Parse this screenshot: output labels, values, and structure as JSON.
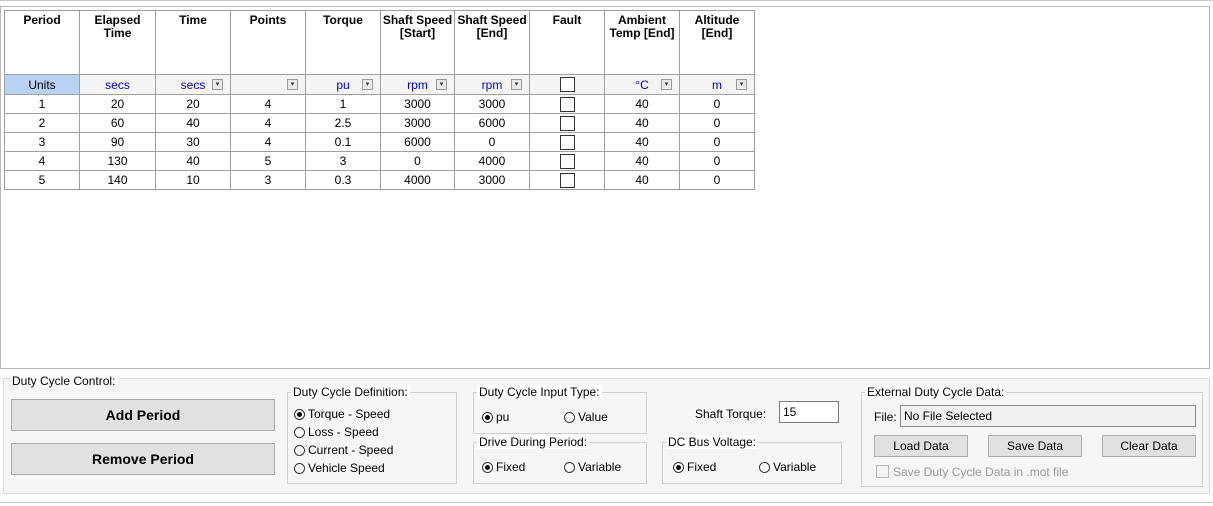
{
  "grid": {
    "columns": [
      {
        "key": "period",
        "header": "Period",
        "unit": "Units",
        "has_dropdown": false
      },
      {
        "key": "elapsed",
        "header": "Elapsed Time",
        "unit": "secs",
        "has_dropdown": false
      },
      {
        "key": "time",
        "header": "Time",
        "unit": "secs",
        "has_dropdown": true
      },
      {
        "key": "points",
        "header": "Points",
        "unit": "",
        "has_dropdown": true
      },
      {
        "key": "torque",
        "header": "Torque",
        "unit": "pu",
        "has_dropdown": true
      },
      {
        "key": "speed_start",
        "header": "Shaft Speed [Start]",
        "unit": "rpm",
        "has_dropdown": true
      },
      {
        "key": "speed_end",
        "header": "Shaft Speed [End]",
        "unit": "rpm",
        "has_dropdown": true
      },
      {
        "key": "fault",
        "header": "Fault",
        "unit": "",
        "has_dropdown": false
      },
      {
        "key": "ambient",
        "header": "Ambient Temp [End]",
        "unit": "°C",
        "has_dropdown": true
      },
      {
        "key": "altitude",
        "header": "Altitude [End]",
        "unit": "m",
        "has_dropdown": true
      }
    ],
    "rows": [
      {
        "period": "1",
        "elapsed": "20",
        "time": "20",
        "points": "4",
        "torque": "1",
        "speed_start": "3000",
        "speed_end": "3000",
        "fault": false,
        "ambient": "40",
        "altitude": "0"
      },
      {
        "period": "2",
        "elapsed": "60",
        "time": "40",
        "points": "4",
        "torque": "2.5",
        "speed_start": "3000",
        "speed_end": "6000",
        "fault": false,
        "ambient": "40",
        "altitude": "0"
      },
      {
        "period": "3",
        "elapsed": "90",
        "time": "30",
        "points": "4",
        "torque": "0.1",
        "speed_start": "6000",
        "speed_end": "0",
        "fault": false,
        "ambient": "40",
        "altitude": "0"
      },
      {
        "period": "4",
        "elapsed": "130",
        "time": "40",
        "points": "5",
        "torque": "3",
        "speed_start": "0",
        "speed_end": "4000",
        "fault": false,
        "ambient": "40",
        "altitude": "0"
      },
      {
        "period": "5",
        "elapsed": "140",
        "time": "10",
        "points": "3",
        "torque": "0.3",
        "speed_start": "4000",
        "speed_end": "3000",
        "fault": false,
        "ambient": "40",
        "altitude": "0"
      }
    ]
  },
  "control": {
    "title": "Duty Cycle Control:",
    "add_period": "Add Period",
    "remove_period": "Remove Period",
    "definition": {
      "title": "Duty Cycle Definition:",
      "options": [
        "Torque - Speed",
        "Loss - Speed",
        "Current - Speed",
        "Vehicle Speed"
      ],
      "selected_index": 0
    },
    "input_type": {
      "title": "Duty Cycle Input Type:",
      "options": [
        "pu",
        "Value"
      ],
      "selected_index": 0
    },
    "drive_during_period": {
      "title": "Drive During Period:",
      "options": [
        "Fixed",
        "Variable"
      ],
      "selected_index": 0
    },
    "shaft_torque": {
      "label": "Shaft Torque:",
      "value": "15"
    },
    "dc_bus_voltage": {
      "title": "DC Bus Voltage:",
      "options": [
        "Fixed",
        "Variable"
      ],
      "selected_index": 0
    },
    "external": {
      "title": "External Duty Cycle Data:",
      "file_label": "File:",
      "file_value": "No File Selected",
      "load": "Load Data",
      "save": "Save Data",
      "clear": "Clear Data",
      "save_in_mot": "Save Duty Cycle Data in .mot file",
      "save_in_mot_checked": false
    }
  }
}
